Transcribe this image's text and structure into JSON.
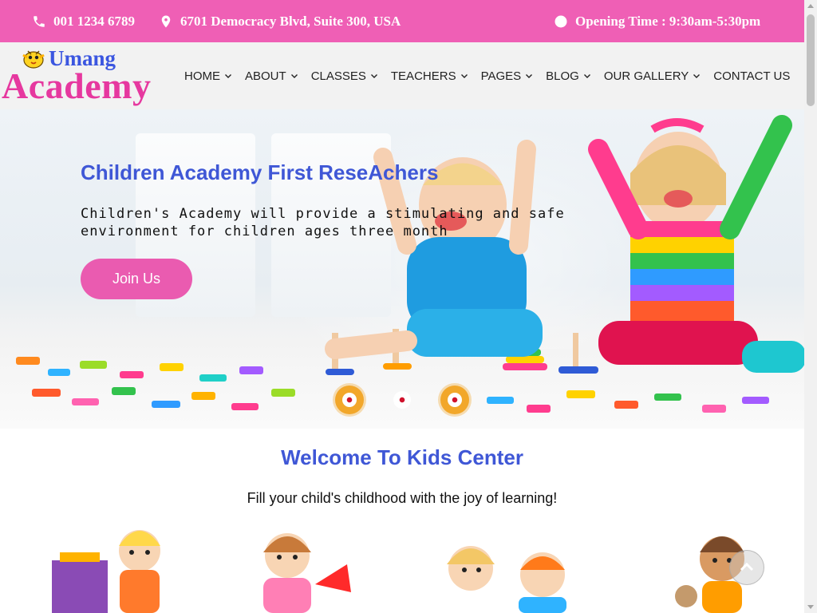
{
  "topbar": {
    "phone": "001 1234 6789",
    "address": "6701 Democracy Blvd, Suite 300, USA",
    "hours": "Opening Time : 9:30am-5:30pm",
    "icons": [
      "phone-icon",
      "map-marker-icon",
      "clock-icon"
    ]
  },
  "logo": {
    "line1": "Umang",
    "line2": "Academy"
  },
  "nav": {
    "home": "HOME",
    "about": "ABOUT",
    "classes": "CLASSES",
    "teachers": "TEACHERS",
    "pages": "PAGES",
    "blog": "BLOG",
    "gallery": "OUR GALLERY",
    "contact": "CONTACT US"
  },
  "hero": {
    "title": "Children Academy First ReseAchers",
    "text": "Children's Academy will provide a stimulating and safe environment for children ages three month",
    "button": "Join Us",
    "slides_total": 3,
    "active_slide": 2
  },
  "welcome": {
    "title": "Welcome To Kids Center",
    "subtitle": "Fill your child's childhood with the joy of learning!"
  },
  "colors": {
    "topbar": "#ef5fb5",
    "accent_blue": "#3f57d6",
    "logo_pink": "#e6389f",
    "button_pink": "#ea5bb0",
    "dot_orange": "#f2a72a"
  }
}
